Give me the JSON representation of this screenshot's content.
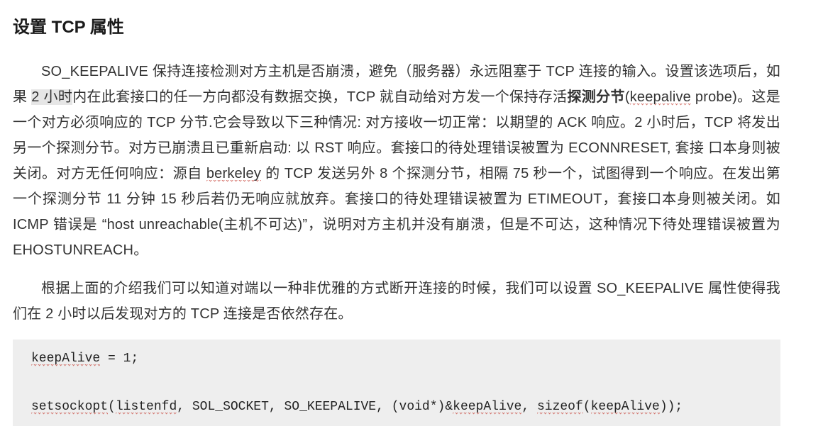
{
  "title": "设置 TCP 属性",
  "para1_parts": {
    "t1": "SO_KEEPALIVE  保持连接检测对方主机是否崩溃，避免（服务器）永远阻塞于 TCP 连接的输入。设置该选项后，如果 ",
    "hl": "2 小时",
    "t2": "内在此套接口的任一方向都没有数据交换，TCP 就自动给对方发一个保持存活",
    "bold": "探测分节",
    "t3": "(",
    "sq1": "keepalive",
    "t4": " probe)。这是一个对方必须响应的 TCP 分节.它会导致以下三种情况: 对方接收一切正常：以期望的 ACK 响应。2 小时后，TCP 将发出另一个探测分节。对方已崩溃且已重新启动: 以 RST 响应。套接口的待处理错误被置为 ECONNRESET, 套接  口本身则被关闭。对方无任何响应：源自 ",
    "sq2": "berkeley",
    "t5": " 的 TCP 发送另外 8 个探测分节，相隔 75 秒一个，试图得到一个响应。在发出第一个探测分节 11 分钟  15 秒后若仍无响应就放弃。套接口的待处理错误被置为 ETIMEOUT，套接口本身则被关闭。如 ICMP 错误是 “host unreachable(主机不可达)”，说明对方主机并没有崩溃，但是不可达，这种情况下待处理错误被置为 EHOSTUNREACH。"
  },
  "para2": "根据上面的介绍我们可以知道对端以一种非优雅的方式断开连接的时候，我们可以设置 SO_KEEPALIVE 属性使得我们在 2 小时以后发现对方的 TCP 连接是否依然存在。",
  "code": {
    "l1a": "keepAlive",
    "l1b": " = 1;",
    "l2a": "setsockopt",
    "l2b": "(",
    "l2c": "listenfd",
    "l2d": ", SOL_SOCKET, SO_KEEPALIVE, (void*)&",
    "l2e": "keepAlive",
    "l2f": ", ",
    "l2g": "sizeof",
    "l2h": "(",
    "l2i": "keepAlive",
    "l2j": "));"
  }
}
